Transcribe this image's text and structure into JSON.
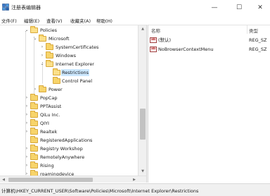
{
  "window": {
    "title": "注册表编辑器",
    "minimize_glyph": "—",
    "maximize_glyph": "☐",
    "close_glyph": "✕"
  },
  "menu": [
    "文件(F)",
    "编辑(E)",
    "查看(V)",
    "收藏夹(A)",
    "帮助(H)"
  ],
  "tree": {
    "selected": "Restrictions",
    "nodes": [
      {
        "label": "Policies",
        "state": "expanded"
      },
      {
        "label": "Microsoft",
        "state": "expanded"
      },
      {
        "label": "SystemCertificates",
        "state": "collapsed"
      },
      {
        "label": "Windows",
        "state": "collapsed"
      },
      {
        "label": "Internet Explorer",
        "state": "expanded"
      },
      {
        "label": "Restrictions",
        "state": "leaf"
      },
      {
        "label": "Control Panel",
        "state": "leaf"
      },
      {
        "label": "Power",
        "state": "collapsed"
      },
      {
        "label": "PopCap",
        "state": "collapsed"
      },
      {
        "label": "PPTAssist",
        "state": "collapsed"
      },
      {
        "label": "QiLu Inc.",
        "state": "collapsed"
      },
      {
        "label": "QIYI",
        "state": "collapsed"
      },
      {
        "label": "Realtek",
        "state": "collapsed"
      },
      {
        "label": "RegisteredApplications",
        "state": "leaf"
      },
      {
        "label": "Registry Workshop",
        "state": "collapsed"
      },
      {
        "label": "RemotelyAnywhere",
        "state": "collapsed"
      },
      {
        "label": "Rising",
        "state": "collapsed"
      },
      {
        "label": "roamingdevice",
        "state": "collapsed"
      }
    ]
  },
  "values": {
    "columns": [
      "名称",
      "类型"
    ],
    "rows": [
      {
        "name": "(默认)",
        "type": "REG_SZ",
        "icon": "ab-string-icon",
        "icon_text": "ab"
      },
      {
        "name": "NoBrowserContextMenu",
        "type": "REG_SZ",
        "icon": "ab-string-icon",
        "icon_text": "ab"
      }
    ]
  },
  "status": {
    "path": "计算机\\HKEY_CURRENT_USER\\Software\\Policies\\Microsoft\\Internet Explorer\\Restrictions"
  },
  "colors": {
    "selection": "#cce8ff",
    "folder": "#f7d46b",
    "status_bar": "#f0f0f0"
  }
}
